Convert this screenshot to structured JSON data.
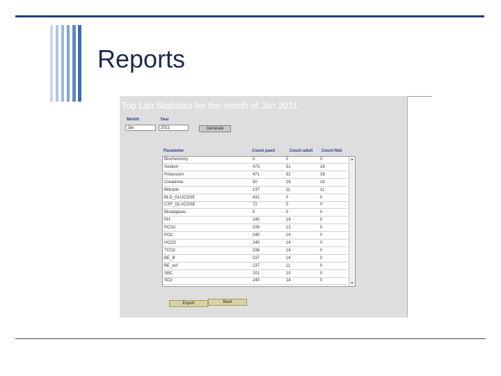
{
  "slide": {
    "title": "Reports"
  },
  "report": {
    "title": "Top Lab Statistics for the month of Jan 2011",
    "month_label": "Month",
    "year_label": "Year",
    "month_value": "Jan",
    "year_value": "2011",
    "generate_label": "Generate",
    "export_label": "Export",
    "back_label": "Back",
    "columns": [
      "Parameter",
      "Count paed",
      "Count adult",
      "Count Mat"
    ],
    "rows": [
      [
        "Biochemistry",
        "0",
        "0",
        "0"
      ],
      [
        "Sodium",
        "473",
        "51",
        "18"
      ],
      [
        "Potassium",
        "471",
        "52",
        "18"
      ],
      [
        "Creatinine",
        "50",
        "29",
        "18"
      ],
      [
        "Bilirubin",
        "137",
        "11",
        "11"
      ],
      [
        "BLD_GLUCOSE",
        "431",
        "0",
        "0"
      ],
      [
        "CSF_GLUCOSE",
        "72",
        "0",
        "0"
      ],
      [
        "Bloodgases",
        "0",
        "0",
        "0"
      ],
      [
        "PH",
        "240",
        "14",
        "0"
      ],
      [
        "PCO2",
        "239",
        "13",
        "0"
      ],
      [
        "PO2",
        "240",
        "14",
        "0"
      ],
      [
        "HCO3",
        "240",
        "14",
        "0"
      ],
      [
        "TCO2",
        "238",
        "14",
        "0"
      ],
      [
        "BE_B",
        "237",
        "14",
        "0"
      ],
      [
        "BE_ecf",
        "237",
        "11",
        "0"
      ],
      [
        "SBC",
        "201",
        "10",
        "0"
      ],
      [
        "SO2",
        "240",
        "14",
        "0"
      ]
    ]
  }
}
